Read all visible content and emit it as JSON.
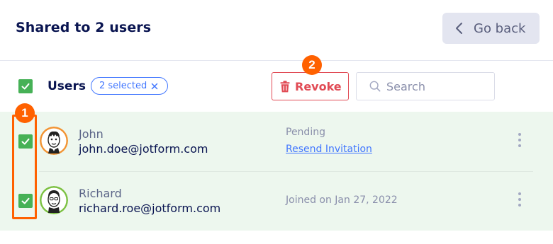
{
  "header": {
    "title": "Shared to 2 users",
    "go_back_label": "Go back"
  },
  "toolbar": {
    "users_label": "Users",
    "selected_badge": "2 selected",
    "revoke_label": "Revoke",
    "search_placeholder": "Search"
  },
  "users": [
    {
      "name": "John",
      "email": "john.doe@jotform.com",
      "status": "Pending",
      "action": "Resend Invitation",
      "checked": true,
      "avatar": "avatar-john-icon"
    },
    {
      "name": "Richard",
      "email": "richard.roe@jotform.com",
      "status": "Joined on Jan 27, 2022",
      "checked": true,
      "avatar": "avatar-richard-icon"
    }
  ],
  "annotations": {
    "marker_1": "1",
    "marker_2": "2"
  },
  "colors": {
    "accent_green": "#46b156",
    "danger_red": "#e14b55",
    "link_blue": "#4277ff",
    "annotation_orange": "#ff6100",
    "row_highlight": "#edf7ee"
  }
}
